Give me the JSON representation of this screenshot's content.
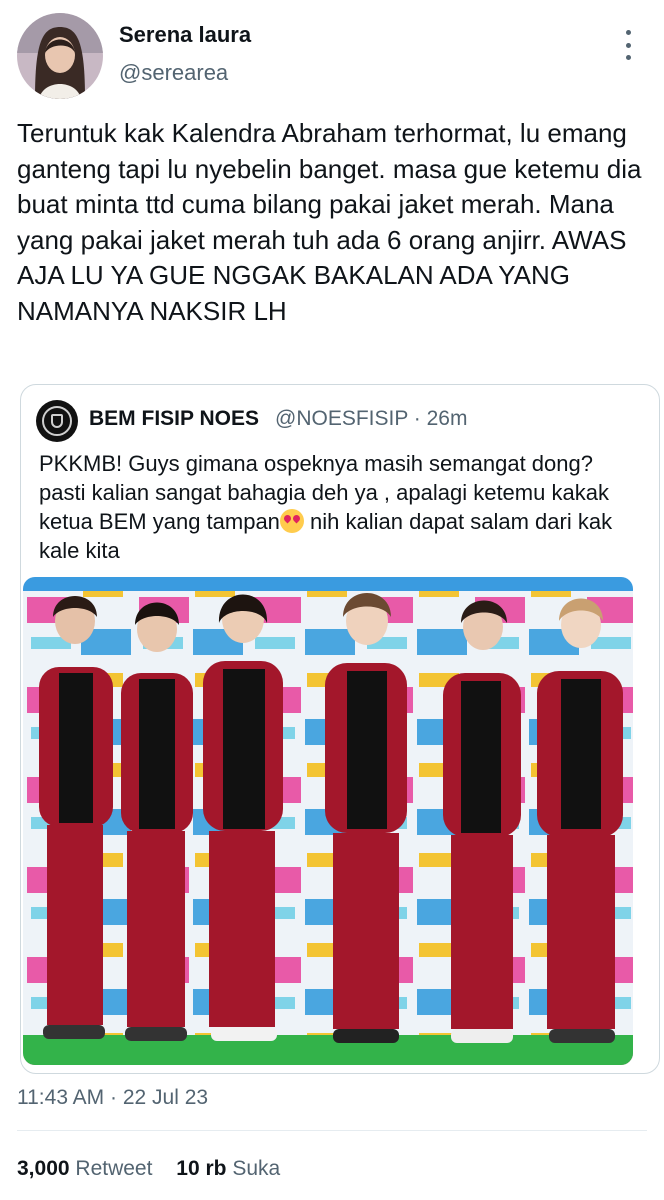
{
  "author": {
    "display_name": "Serena laura",
    "handle": "@serearea"
  },
  "tweet": {
    "text": "Teruntuk kak Kalendra Abraham terhormat, lu emang ganteng tapi lu nyebelin banget. masa gue ketemu dia buat minta ttd cuma bilang pakai jaket merah. Mana yang pakai jaket merah tuh ada 6 orang anjirr. AWAS AJA LU YA GUE NGGAK BAKALAN ADA YANG NAMANYA NAKSIR LH",
    "timestamp": "11:43 AM · 22 Jul 23"
  },
  "quoted": {
    "name": "BEM FISIP NOES",
    "meta": "@NOESFISIP · 26m",
    "text_before": "PKKMB! Guys gimana ospeknya masih semangat dong? pasti kalian sangat bahagia deh ya , apalagi ketemu kakak ketua BEM yang tampan",
    "emoji": "heart-eyes-emoji",
    "text_after": " nih kalian dapat salam dari kak kale kita"
  },
  "stats": {
    "retweets_count": "3,000",
    "retweets_label": "Retweet",
    "likes_count": "10 rb",
    "likes_label": "Suka"
  },
  "colors": {
    "text": "#0f1419",
    "secondary": "#536471",
    "border": "#cfd9de",
    "jacket_red": "#a3172b"
  },
  "icons": [
    "more-vertical-icon",
    "heart-eyes-emoji"
  ]
}
